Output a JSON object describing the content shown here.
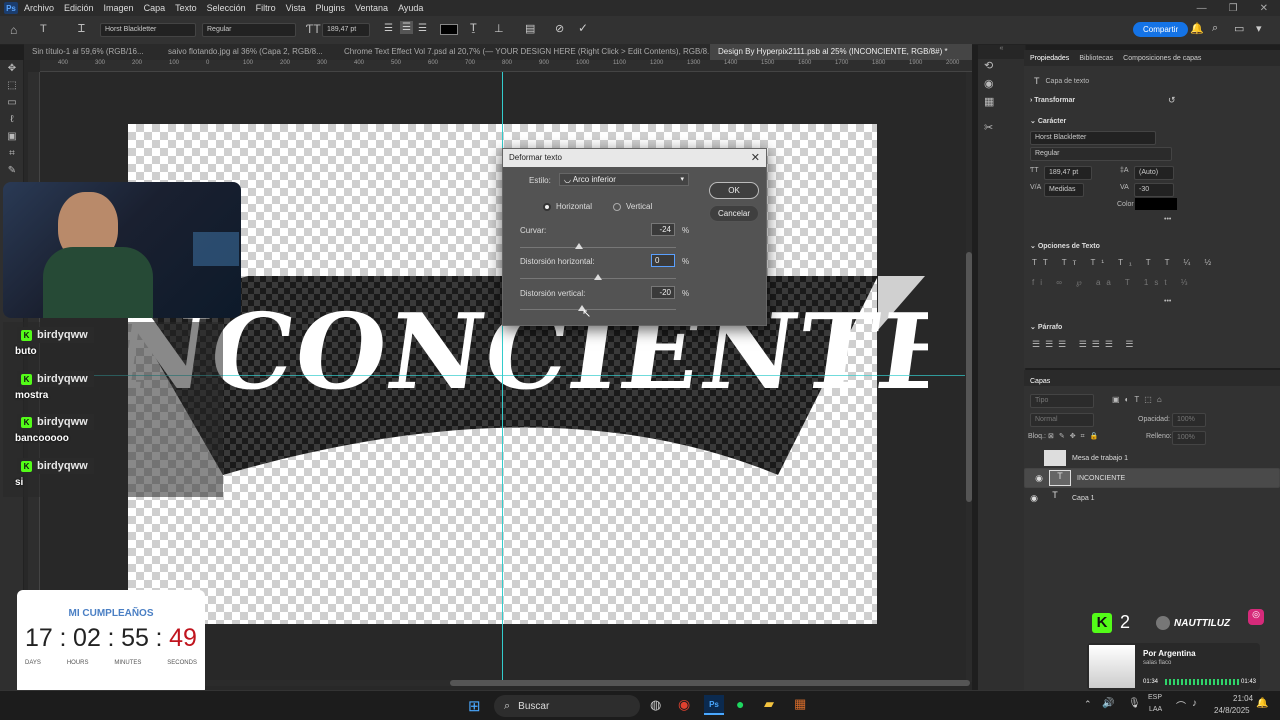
{
  "app": {
    "logo": "Ps",
    "menu": [
      "Archivo",
      "Edición",
      "Imagen",
      "Capa",
      "Texto",
      "Selección",
      "Filtro",
      "Vista",
      "Plugins",
      "Ventana",
      "Ayuda"
    ],
    "window_controls": [
      "—",
      "❐",
      "✕"
    ]
  },
  "options_bar": {
    "font_family": "Horst Blackletter",
    "font_style": "Regular",
    "font_size": "189,47 pt",
    "share_button": "Compartir"
  },
  "tabs": [
    "Sin título-1 al 59,6% (RGB/16...",
    "saivo flotando.jpg al 36% (Capa 2, RGB/8...",
    "Chrome Text Effect Vol 7.psd al 20,7% (— YOUR DESIGN HERE (Right Click > Edit Contents), RGB/8...",
    "Design By Hyperpix2111.psb al 25% (INCONCIENTE, RGB/8#) *"
  ],
  "ruler_labels": [
    "400",
    "300",
    "200",
    "100",
    "0",
    "100",
    "200",
    "300",
    "400",
    "500",
    "600",
    "700",
    "800",
    "900",
    "1000",
    "1100",
    "1200",
    "1300",
    "1400",
    "1500",
    "1600",
    "1700",
    "1800",
    "1900",
    "2000"
  ],
  "canvas": {
    "warped_text": "INCONCIENTE"
  },
  "dialog": {
    "title": "Deformar texto",
    "style_label": "Estilo:",
    "style_value": "Arco inferior",
    "ok": "OK",
    "cancel": "Cancelar",
    "orientation": {
      "horizontal": "Horizontal",
      "vertical": "Vertical",
      "selected": "horizontal"
    },
    "bend_label": "Curvar:",
    "bend_value": "-24",
    "hdist_label": "Distorsión horizontal:",
    "hdist_value": "0",
    "vdist_label": "Distorsión vertical:",
    "vdist_value": "-20",
    "percent": "%"
  },
  "properties": {
    "tabs": [
      "Propiedades",
      "Bibliotecas",
      "Composiciones de capas"
    ],
    "layer_type": "Capa de texto",
    "transform": "Transformar",
    "character": "Carácter",
    "font_family": "Horst Blackletter",
    "font_style": "Regular",
    "font_size": "189,47 pt",
    "leading": "(Auto)",
    "kerning": "Medidas",
    "tracking": "-30",
    "color_label": "Color",
    "text_options": "Opciones de Texto",
    "paragraph": "Párrafo"
  },
  "layers": {
    "title": "Capas",
    "search_placeholder": "Tipo",
    "blend_mode": "Normal",
    "opacity_label": "Opacidad:",
    "opacity_value": "100%",
    "lock_label": "Bloq.:",
    "fill_label": "Relleno:",
    "fill_value": "100%",
    "items": [
      {
        "name": "Mesa de trabajo 1",
        "visible": false
      },
      {
        "name": "INCONCIENTE",
        "visible": true
      },
      {
        "name": "Capa 1",
        "visible": true
      }
    ]
  },
  "chat": [
    {
      "user": "birdyqww",
      "message": "buto"
    },
    {
      "user": "birdyqww",
      "message": "mostra"
    },
    {
      "user": "birdyqww",
      "message": "bancooooo"
    },
    {
      "user": "birdyqww",
      "message": "si"
    }
  ],
  "countdown": {
    "title": "MI CUMPLEAÑOS",
    "days": "17",
    "hours": "02",
    "minutes": "55",
    "seconds": "49",
    "labels": [
      "DAYS",
      "HOURS",
      "MINUTES",
      "SECONDS"
    ]
  },
  "stream": {
    "kick_count": "2",
    "streamer": "NAUTTILUZ"
  },
  "now_playing": {
    "title": "Por Argentina",
    "artist": "salas flaco",
    "elapsed": "01:34",
    "total": "01:43"
  },
  "taskbar": {
    "search": "Buscar",
    "lang_top": "ESP",
    "lang_bottom": "LAA",
    "time": "21:04",
    "date": "24/8/2025"
  }
}
